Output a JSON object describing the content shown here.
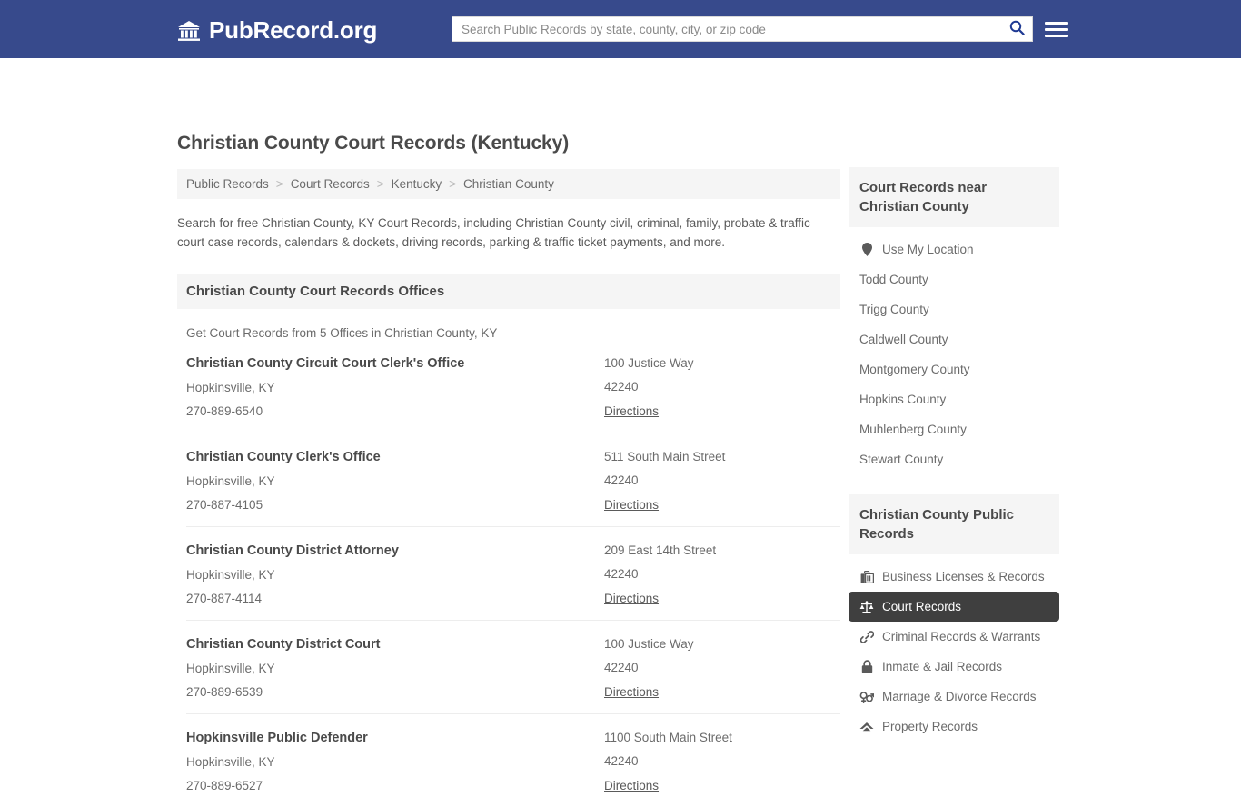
{
  "header": {
    "brand_name": "PubRecord.org",
    "brand_icon": "bank-icon",
    "search_placeholder": "Search Public Records by state, county, city, or zip code",
    "search_value": "",
    "search_icon": "search-icon",
    "menu_icon": "hamburger-menu-icon",
    "bg_color": "#374a8c"
  },
  "main": {
    "title": "Christian County Court Records (Kentucky)",
    "breadcrumb": [
      "Public Records",
      "Court Records",
      "Kentucky",
      "Christian County"
    ],
    "breadcrumb_separator": ">",
    "intro": "Search for free Christian County, KY Court Records, including Christian County civil, criminal, family, probate & traffic court case records, calendars & dockets, driving records, parking & traffic ticket payments, and more.",
    "section_title": "Christian County Court Records Offices",
    "section_subtitle": "Get Court Records from 5 Offices in Christian County, KY",
    "directions_label": "Directions",
    "offices": [
      {
        "name": "Christian County Circuit Court Clerk's Office",
        "city_state": "Hopkinsville, KY",
        "phone": "270-889-6540",
        "street": "100 Justice Way",
        "zip": "42240"
      },
      {
        "name": "Christian County Clerk's Office",
        "city_state": "Hopkinsville, KY",
        "phone": "270-887-4105",
        "street": "511 South Main Street",
        "zip": "42240"
      },
      {
        "name": "Christian County District Attorney",
        "city_state": "Hopkinsville, KY",
        "phone": "270-887-4114",
        "street": "209 East 14th Street",
        "zip": "42240"
      },
      {
        "name": "Christian County District Court",
        "city_state": "Hopkinsville, KY",
        "phone": "270-889-6539",
        "street": "100 Justice Way",
        "zip": "42240"
      },
      {
        "name": "Hopkinsville Public Defender",
        "city_state": "Hopkinsville, KY",
        "phone": "270-889-6527",
        "street": "1100 South Main Street",
        "zip": "42240"
      }
    ]
  },
  "sidebar": {
    "nearby": {
      "title": "Court Records near Christian County",
      "items": [
        {
          "label": "Use My Location",
          "icon": "map-pin-icon"
        },
        {
          "label": "Todd County",
          "icon": ""
        },
        {
          "label": "Trigg County",
          "icon": ""
        },
        {
          "label": "Caldwell County",
          "icon": ""
        },
        {
          "label": "Montgomery County",
          "icon": ""
        },
        {
          "label": "Hopkins County",
          "icon": ""
        },
        {
          "label": "Muhlenberg County",
          "icon": ""
        },
        {
          "label": "Stewart County",
          "icon": ""
        }
      ]
    },
    "public_records": {
      "title": "Christian County Public Records",
      "active_index": 1,
      "active_bg": "#3f3f3f",
      "items": [
        {
          "label": "Business Licenses & Records",
          "icon": "briefcase-icon"
        },
        {
          "label": "Court Records",
          "icon": "scales-of-justice-icon"
        },
        {
          "label": "Criminal Records & Warrants",
          "icon": "link-chain-icon"
        },
        {
          "label": "Inmate & Jail Records",
          "icon": "lock-icon"
        },
        {
          "label": "Marriage & Divorce Records",
          "icon": "venus-mars-icon"
        },
        {
          "label": "Property Records",
          "icon": "house-icon"
        }
      ]
    }
  }
}
